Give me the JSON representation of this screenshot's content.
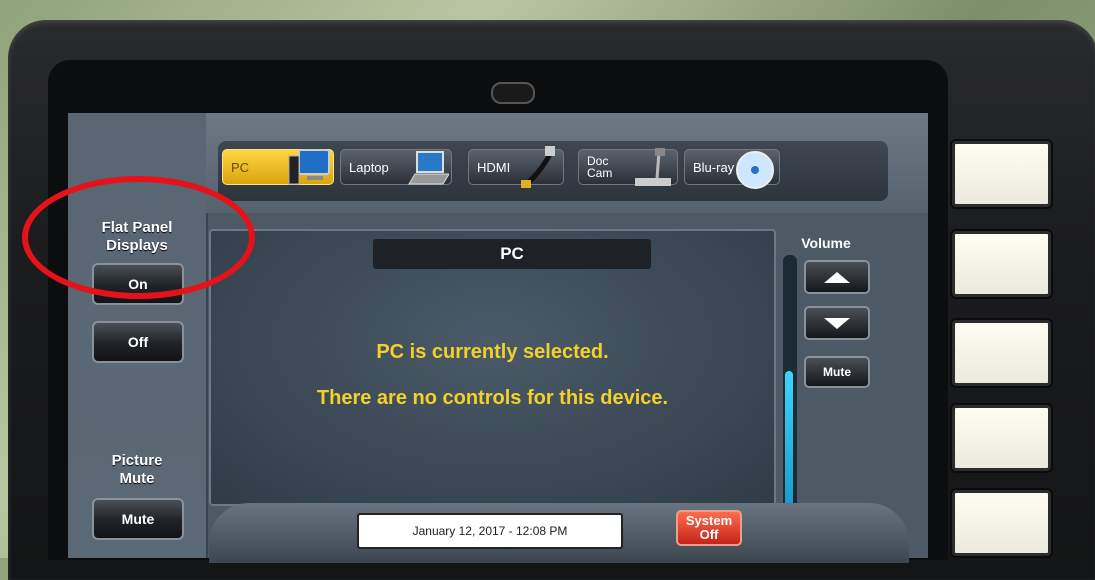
{
  "sources": [
    {
      "label": "PC",
      "icon": "monitor-icon",
      "active": true
    },
    {
      "label": "Laptop",
      "icon": "laptop-icon",
      "active": false
    },
    {
      "label": "HDMI",
      "icon": "hdmi-cable-icon",
      "active": false
    },
    {
      "label": "Doc\nCam",
      "icon": "document-camera-icon",
      "active": false
    },
    {
      "label": "Blu-ray",
      "icon": "disc-icon",
      "active": false
    }
  ],
  "left_panel": {
    "flat_panel_title": "Flat Panel\nDisplays",
    "on_label": "On",
    "off_label": "Off",
    "picture_mute_title": "Picture\nMute",
    "mute_label": "Mute"
  },
  "main": {
    "title": "PC",
    "line1": "PC is currently selected.",
    "line2": "There are no controls for this device."
  },
  "volume": {
    "title": "Volume",
    "mute_label": "Mute",
    "level": 0.55
  },
  "footer": {
    "date_time": "January 12, 2017  -  12:08 PM",
    "system_off_line1": "System",
    "system_off_line2": "Off"
  },
  "colors": {
    "accent_yellow": "#f2d12a",
    "active_source": "#ffd640",
    "system_off": "#d8301f",
    "highlight_circle": "#e5121a"
  }
}
